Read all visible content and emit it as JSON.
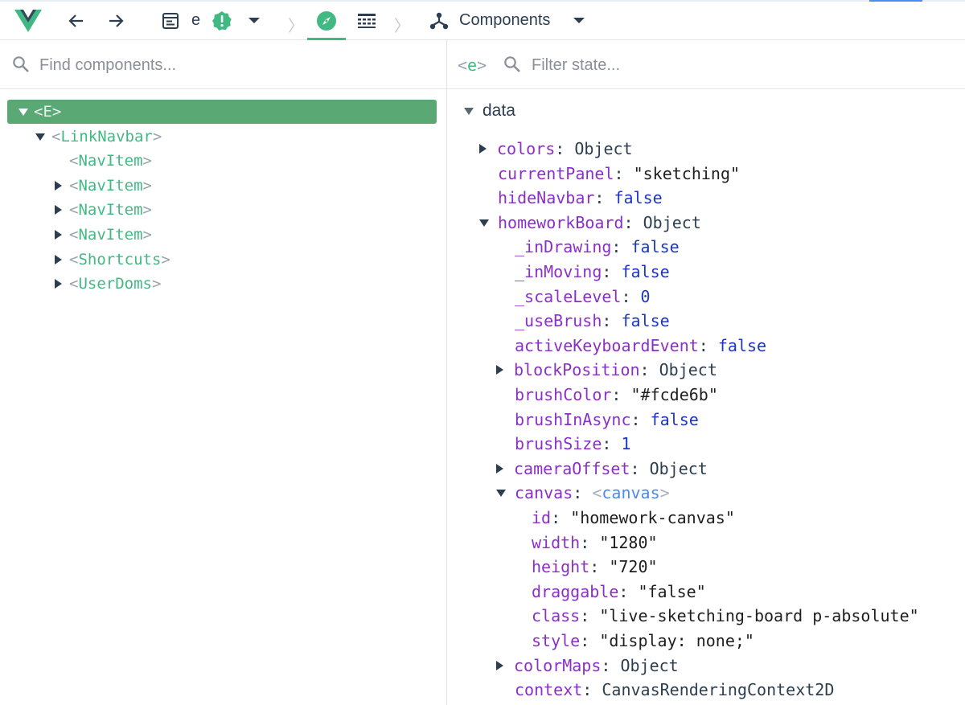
{
  "toolbar": {
    "logo": "vue-logo",
    "app_name": "e",
    "components_label": "Components",
    "accent_color": "#42b983"
  },
  "left": {
    "search_placeholder": "Find components...",
    "tree": [
      {
        "name": "E",
        "selected": true
      },
      {
        "name": "LinkNavbar"
      },
      {
        "name": "NavItem"
      },
      {
        "name": "NavItem"
      },
      {
        "name": "NavItem"
      },
      {
        "name": "NavItem"
      },
      {
        "name": "Shortcuts"
      },
      {
        "name": "UserDoms"
      }
    ]
  },
  "right": {
    "component_tag": "e",
    "search_placeholder": "Filter state...",
    "section": "data",
    "state": [
      {
        "key": "colors",
        "value": "Object"
      },
      {
        "key": "currentPanel",
        "value": "\"sketching\""
      },
      {
        "key": "hideNavbar",
        "value": "false"
      },
      {
        "key": "homeworkBoard",
        "value": "Object"
      },
      {
        "key": "_inDrawing",
        "value": "false"
      },
      {
        "key": "_inMoving",
        "value": "false"
      },
      {
        "key": "_scaleLevel",
        "value": "0"
      },
      {
        "key": "_useBrush",
        "value": "false"
      },
      {
        "key": "activeKeyboardEvent",
        "value": "false"
      },
      {
        "key": "blockPosition",
        "value": "Object"
      },
      {
        "key": "brushColor",
        "value": "\"#fcde6b\""
      },
      {
        "key": "brushInAsync",
        "value": "false"
      },
      {
        "key": "brushSize",
        "value": "1"
      },
      {
        "key": "cameraOffset",
        "value": "Object"
      },
      {
        "key": "canvas",
        "value": "canvas"
      },
      {
        "key": "id",
        "value": "\"homework-canvas\""
      },
      {
        "key": "width",
        "value": "\"1280\""
      },
      {
        "key": "height",
        "value": "\"720\""
      },
      {
        "key": "draggable",
        "value": "\"false\""
      },
      {
        "key": "class",
        "value": "\"live-sketching-board p-absolute\""
      },
      {
        "key": "style",
        "value": "\"display: none;\""
      },
      {
        "key": "colorMaps",
        "value": "Object"
      },
      {
        "key": "context",
        "value": "CanvasRenderingContext2D"
      }
    ]
  }
}
